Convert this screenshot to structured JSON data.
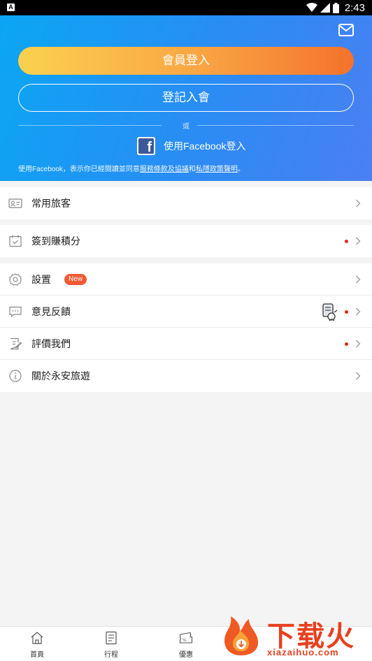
{
  "status_bar": {
    "time": "2:43",
    "notification_icon": "A"
  },
  "hero": {
    "login_label": "會員登入",
    "register_label": "登記入會",
    "or_text": "或",
    "facebook_login_label": "使用Facebook登入",
    "terms": {
      "prefix": "使用Facebook，表示你已經閱讀並同意",
      "service_link": "服務條款及協議",
      "and": "和",
      "privacy_link": "私隱政策聲明",
      "suffix": "。"
    }
  },
  "menu": {
    "group1": [
      {
        "label": "常用旅客",
        "icon": "id-card-icon"
      }
    ],
    "group2": [
      {
        "label": "簽到賺積分",
        "icon": "calendar-check-icon",
        "dot": true
      }
    ],
    "group3": [
      {
        "label": "設置",
        "icon": "gear-icon",
        "badge": "New"
      },
      {
        "label": "意見反饋",
        "icon": "chat-icon",
        "dot": true
      },
      {
        "label": "評價我們",
        "icon": "edit-note-icon",
        "dot": true
      },
      {
        "label": "關於永安旅遊",
        "icon": "info-icon"
      }
    ]
  },
  "tabbar": {
    "tabs": [
      {
        "label": "首頁",
        "icon": "home-icon"
      },
      {
        "label": "行程",
        "icon": "itinerary-icon"
      },
      {
        "label": "優惠",
        "icon": "coupon-icon"
      }
    ]
  },
  "watermark": {
    "text": "下载火",
    "url": "xiazaihuo.com"
  },
  "colors": {
    "accent_orange": "#f4722b",
    "hero_blue": "#0aa7f3",
    "dot_red": "#e8202a",
    "badge_red": "#f25a33"
  }
}
